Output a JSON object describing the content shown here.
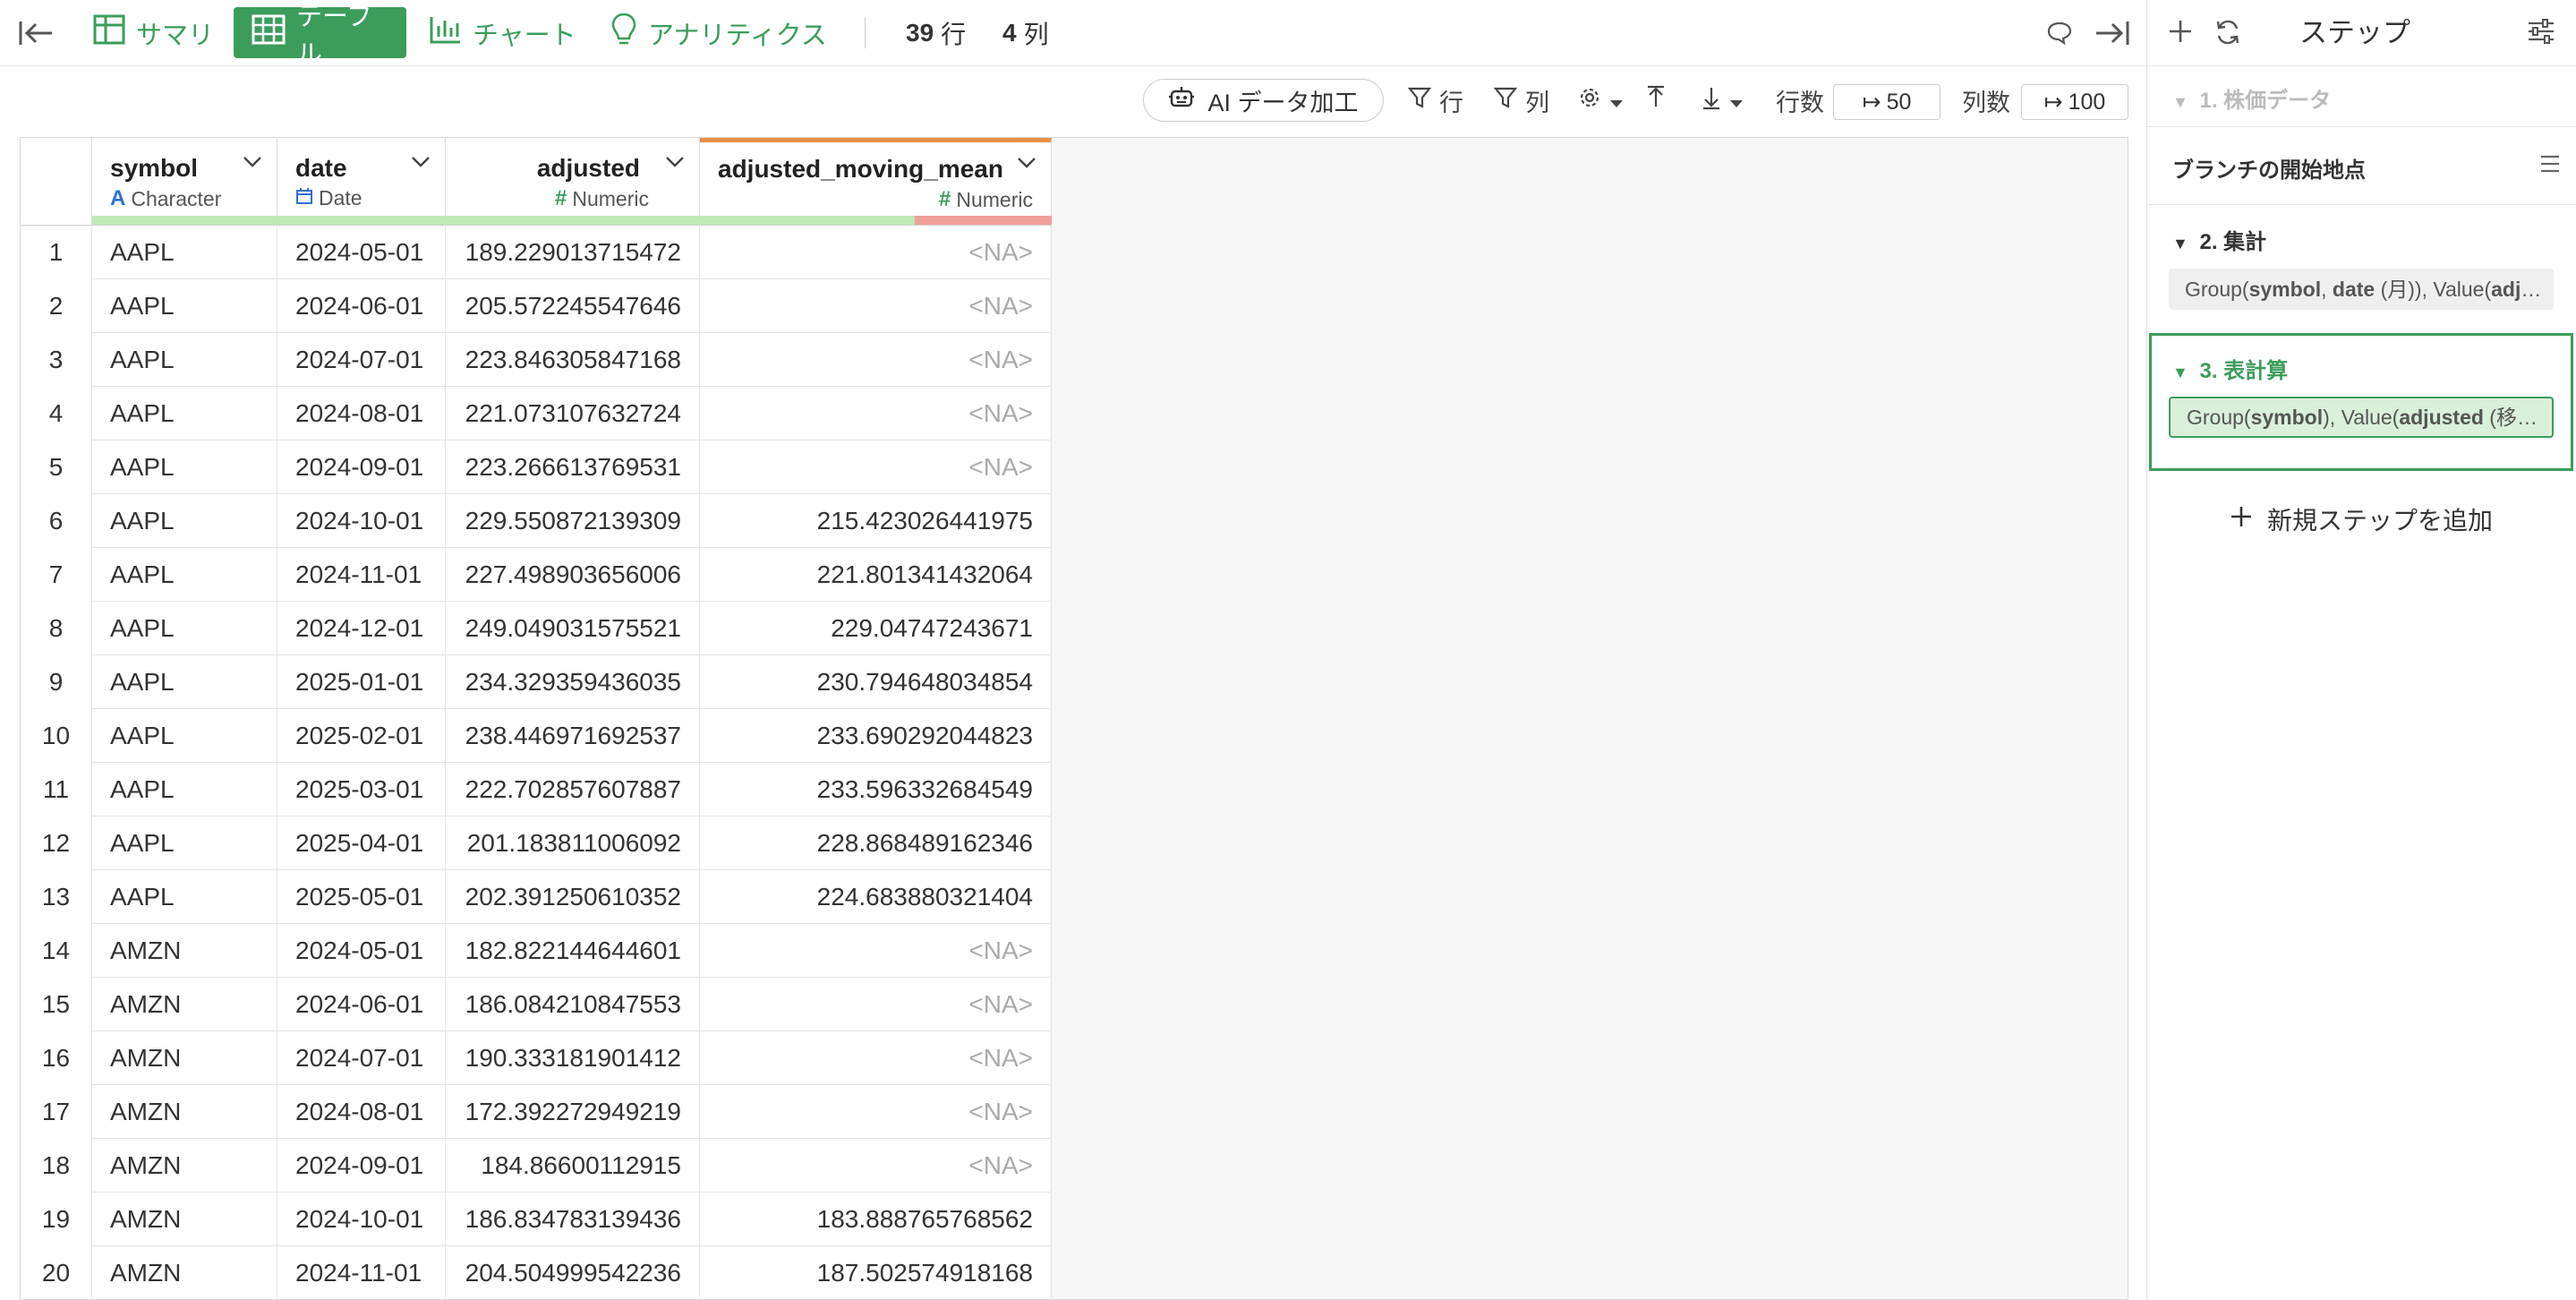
{
  "toolbar": {
    "tabs": [
      {
        "label": "サマリ",
        "icon": "summary-grid-icon"
      },
      {
        "label": "テーブル",
        "icon": "table-icon"
      },
      {
        "label": "チャート",
        "icon": "bar-chart-icon"
      },
      {
        "label": "アナリティクス",
        "icon": "lightbulb-icon"
      }
    ],
    "row_count": "39",
    "row_unit": "行",
    "col_count": "4",
    "col_unit": "列"
  },
  "toolbar2": {
    "ai_label": "AI データ加工",
    "row_filter": "行",
    "col_filter": "列",
    "rows_label": "行数",
    "rows_value": "50",
    "cols_label": "列数",
    "cols_value": "100"
  },
  "columns": [
    {
      "name": "symbol",
      "type": "Character",
      "icon": "character-type-icon"
    },
    {
      "name": "date",
      "type": "Date",
      "icon": "calendar-icon"
    },
    {
      "name": "adjusted",
      "type": "Numeric",
      "icon": "hash-icon"
    },
    {
      "name": "adjusted_moving_mean",
      "type": "Numeric",
      "icon": "hash-icon"
    }
  ],
  "rows": [
    [
      "1",
      "AAPL",
      "2024-05-01",
      "189.229013715472",
      "<NA>"
    ],
    [
      "2",
      "AAPL",
      "2024-06-01",
      "205.572245547646",
      "<NA>"
    ],
    [
      "3",
      "AAPL",
      "2024-07-01",
      "223.846305847168",
      "<NA>"
    ],
    [
      "4",
      "AAPL",
      "2024-08-01",
      "221.073107632724",
      "<NA>"
    ],
    [
      "5",
      "AAPL",
      "2024-09-01",
      "223.266613769531",
      "<NA>"
    ],
    [
      "6",
      "AAPL",
      "2024-10-01",
      "229.550872139309",
      "215.423026441975"
    ],
    [
      "7",
      "AAPL",
      "2024-11-01",
      "227.498903656006",
      "221.801341432064"
    ],
    [
      "8",
      "AAPL",
      "2024-12-01",
      "249.049031575521",
      "229.04747243671"
    ],
    [
      "9",
      "AAPL",
      "2025-01-01",
      "234.329359436035",
      "230.794648034854"
    ],
    [
      "10",
      "AAPL",
      "2025-02-01",
      "238.446971692537",
      "233.690292044823"
    ],
    [
      "11",
      "AAPL",
      "2025-03-01",
      "222.702857607887",
      "233.596332684549"
    ],
    [
      "12",
      "AAPL",
      "2025-04-01",
      "201.183811006092",
      "228.868489162346"
    ],
    [
      "13",
      "AAPL",
      "2025-05-01",
      "202.391250610352",
      "224.683880321404"
    ],
    [
      "14",
      "AMZN",
      "2024-05-01",
      "182.822144644601",
      "<NA>"
    ],
    [
      "15",
      "AMZN",
      "2024-06-01",
      "186.084210847553",
      "<NA>"
    ],
    [
      "16",
      "AMZN",
      "2024-07-01",
      "190.333181901412",
      "<NA>"
    ],
    [
      "17",
      "AMZN",
      "2024-08-01",
      "172.392272949219",
      "<NA>"
    ],
    [
      "18",
      "AMZN",
      "2024-09-01",
      "184.86600112915",
      "<NA>"
    ],
    [
      "19",
      "AMZN",
      "2024-10-01",
      "186.834783139436",
      "183.888765768562"
    ],
    [
      "20",
      "AMZN",
      "2024-11-01",
      "204.504999542236",
      "187.502574918168"
    ]
  ],
  "panel": {
    "title": "ステップ",
    "step1": "1. 株価データ",
    "branch": "ブランチの開始地点",
    "step2_title": "2. 集計",
    "step3_title": "3. 表計算",
    "add_step": "新規ステップを追加"
  },
  "colors": {
    "accent": "#3c9c5c",
    "quality_ok": "#bfe8b8",
    "quality_na": "#f0a09a",
    "active_col": "#e8904a"
  }
}
